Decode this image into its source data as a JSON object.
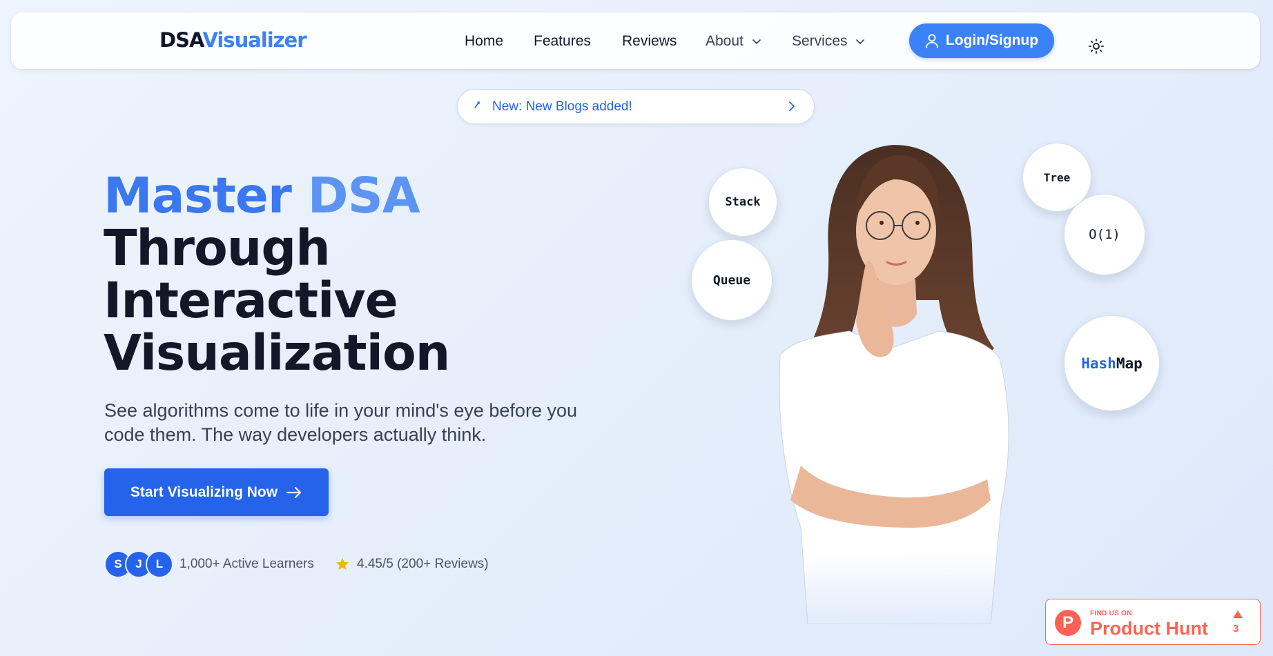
{
  "nav": {
    "logo_part1": "DSA",
    "logo_part2": "Visualizer",
    "links": [
      "Home",
      "Features",
      "Reviews",
      "About",
      "Services"
    ],
    "login_label": "Login/Signup"
  },
  "announcement": {
    "text": "New: New Blogs added!"
  },
  "hero": {
    "title_word1": "Master",
    "title_word2": "DSA",
    "title_line2": "Through",
    "title_line3": "Interactive",
    "title_line4": "Visualization",
    "subtitle": "See algorithms come to life in your mind's eye before you code them. The way developers actually think.",
    "cta_label": "Start Visualizing Now",
    "avatars": [
      "S",
      "J",
      "L"
    ],
    "learners": "1,000+ Active Learners",
    "rating": "4.45/5 (200+ Reviews)"
  },
  "bubbles": {
    "stack": "Stack",
    "queue": "Queue",
    "tree": "Tree",
    "o1": "O(1)",
    "hashmap_part1": "Hash",
    "hashmap_part2": "Map"
  },
  "product_hunt": {
    "find": "FIND US ON",
    "name": "Product Hunt",
    "count": "3"
  },
  "colors": {
    "primary": "#2563eb",
    "accent": "#3b82f6",
    "product_hunt": "#ff6154"
  },
  "icons": [
    "user-icon",
    "chevron-down-icon",
    "sun-icon",
    "sparkle-icon",
    "chevron-right-icon",
    "arrow-right-icon",
    "star-icon",
    "upvote-triangle-icon"
  ]
}
